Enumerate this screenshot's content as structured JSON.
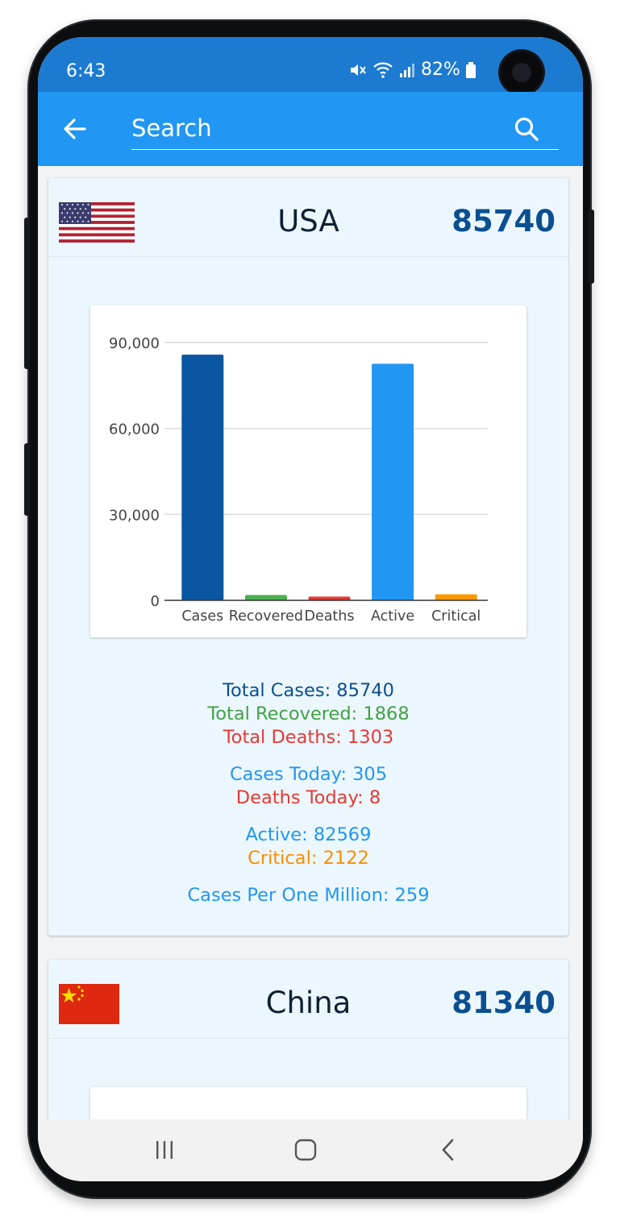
{
  "status": {
    "time": "6:43",
    "battery": "82%"
  },
  "appbar": {
    "search_placeholder": "Search",
    "back_icon": "arrow-left-icon",
    "search_icon": "search-icon"
  },
  "countries": [
    {
      "name": "USA",
      "total": "85740",
      "flag": "usa-flag",
      "chart_data": {
        "type": "bar",
        "categories": [
          "Cases",
          "Recovered",
          "Deaths",
          "Active",
          "Critical"
        ],
        "values": [
          85740,
          1868,
          1303,
          82569,
          2122
        ],
        "colors": [
          "#0a56a0",
          "#4caf50",
          "#e53935",
          "#2196f3",
          "#ff9800"
        ],
        "yticks": [
          "0",
          "30,000",
          "60,000",
          "90,000"
        ],
        "ylim": [
          0,
          90000
        ],
        "grid": true
      },
      "stats": {
        "total_cases": "Total Cases: 85740",
        "total_recovered": "Total Recovered: 1868",
        "total_deaths": "Total Deaths: 1303",
        "cases_today": "Cases Today: 305",
        "deaths_today": "Deaths Today: 8",
        "active": "Active: 82569",
        "critical": "Critical: 2122",
        "per_million": "Cases Per One Million: 259"
      }
    },
    {
      "name": "China",
      "total": "81340",
      "flag": "china-flag"
    }
  ],
  "colors": {
    "appbar": "#2196f3",
    "statusbar": "#1c7bd1",
    "card_bg": "#ecf7fd",
    "cases": "#0a56a0",
    "recovered": "#4caf50",
    "deaths": "#e53935",
    "active": "#2196f3",
    "critical": "#ff9800"
  }
}
